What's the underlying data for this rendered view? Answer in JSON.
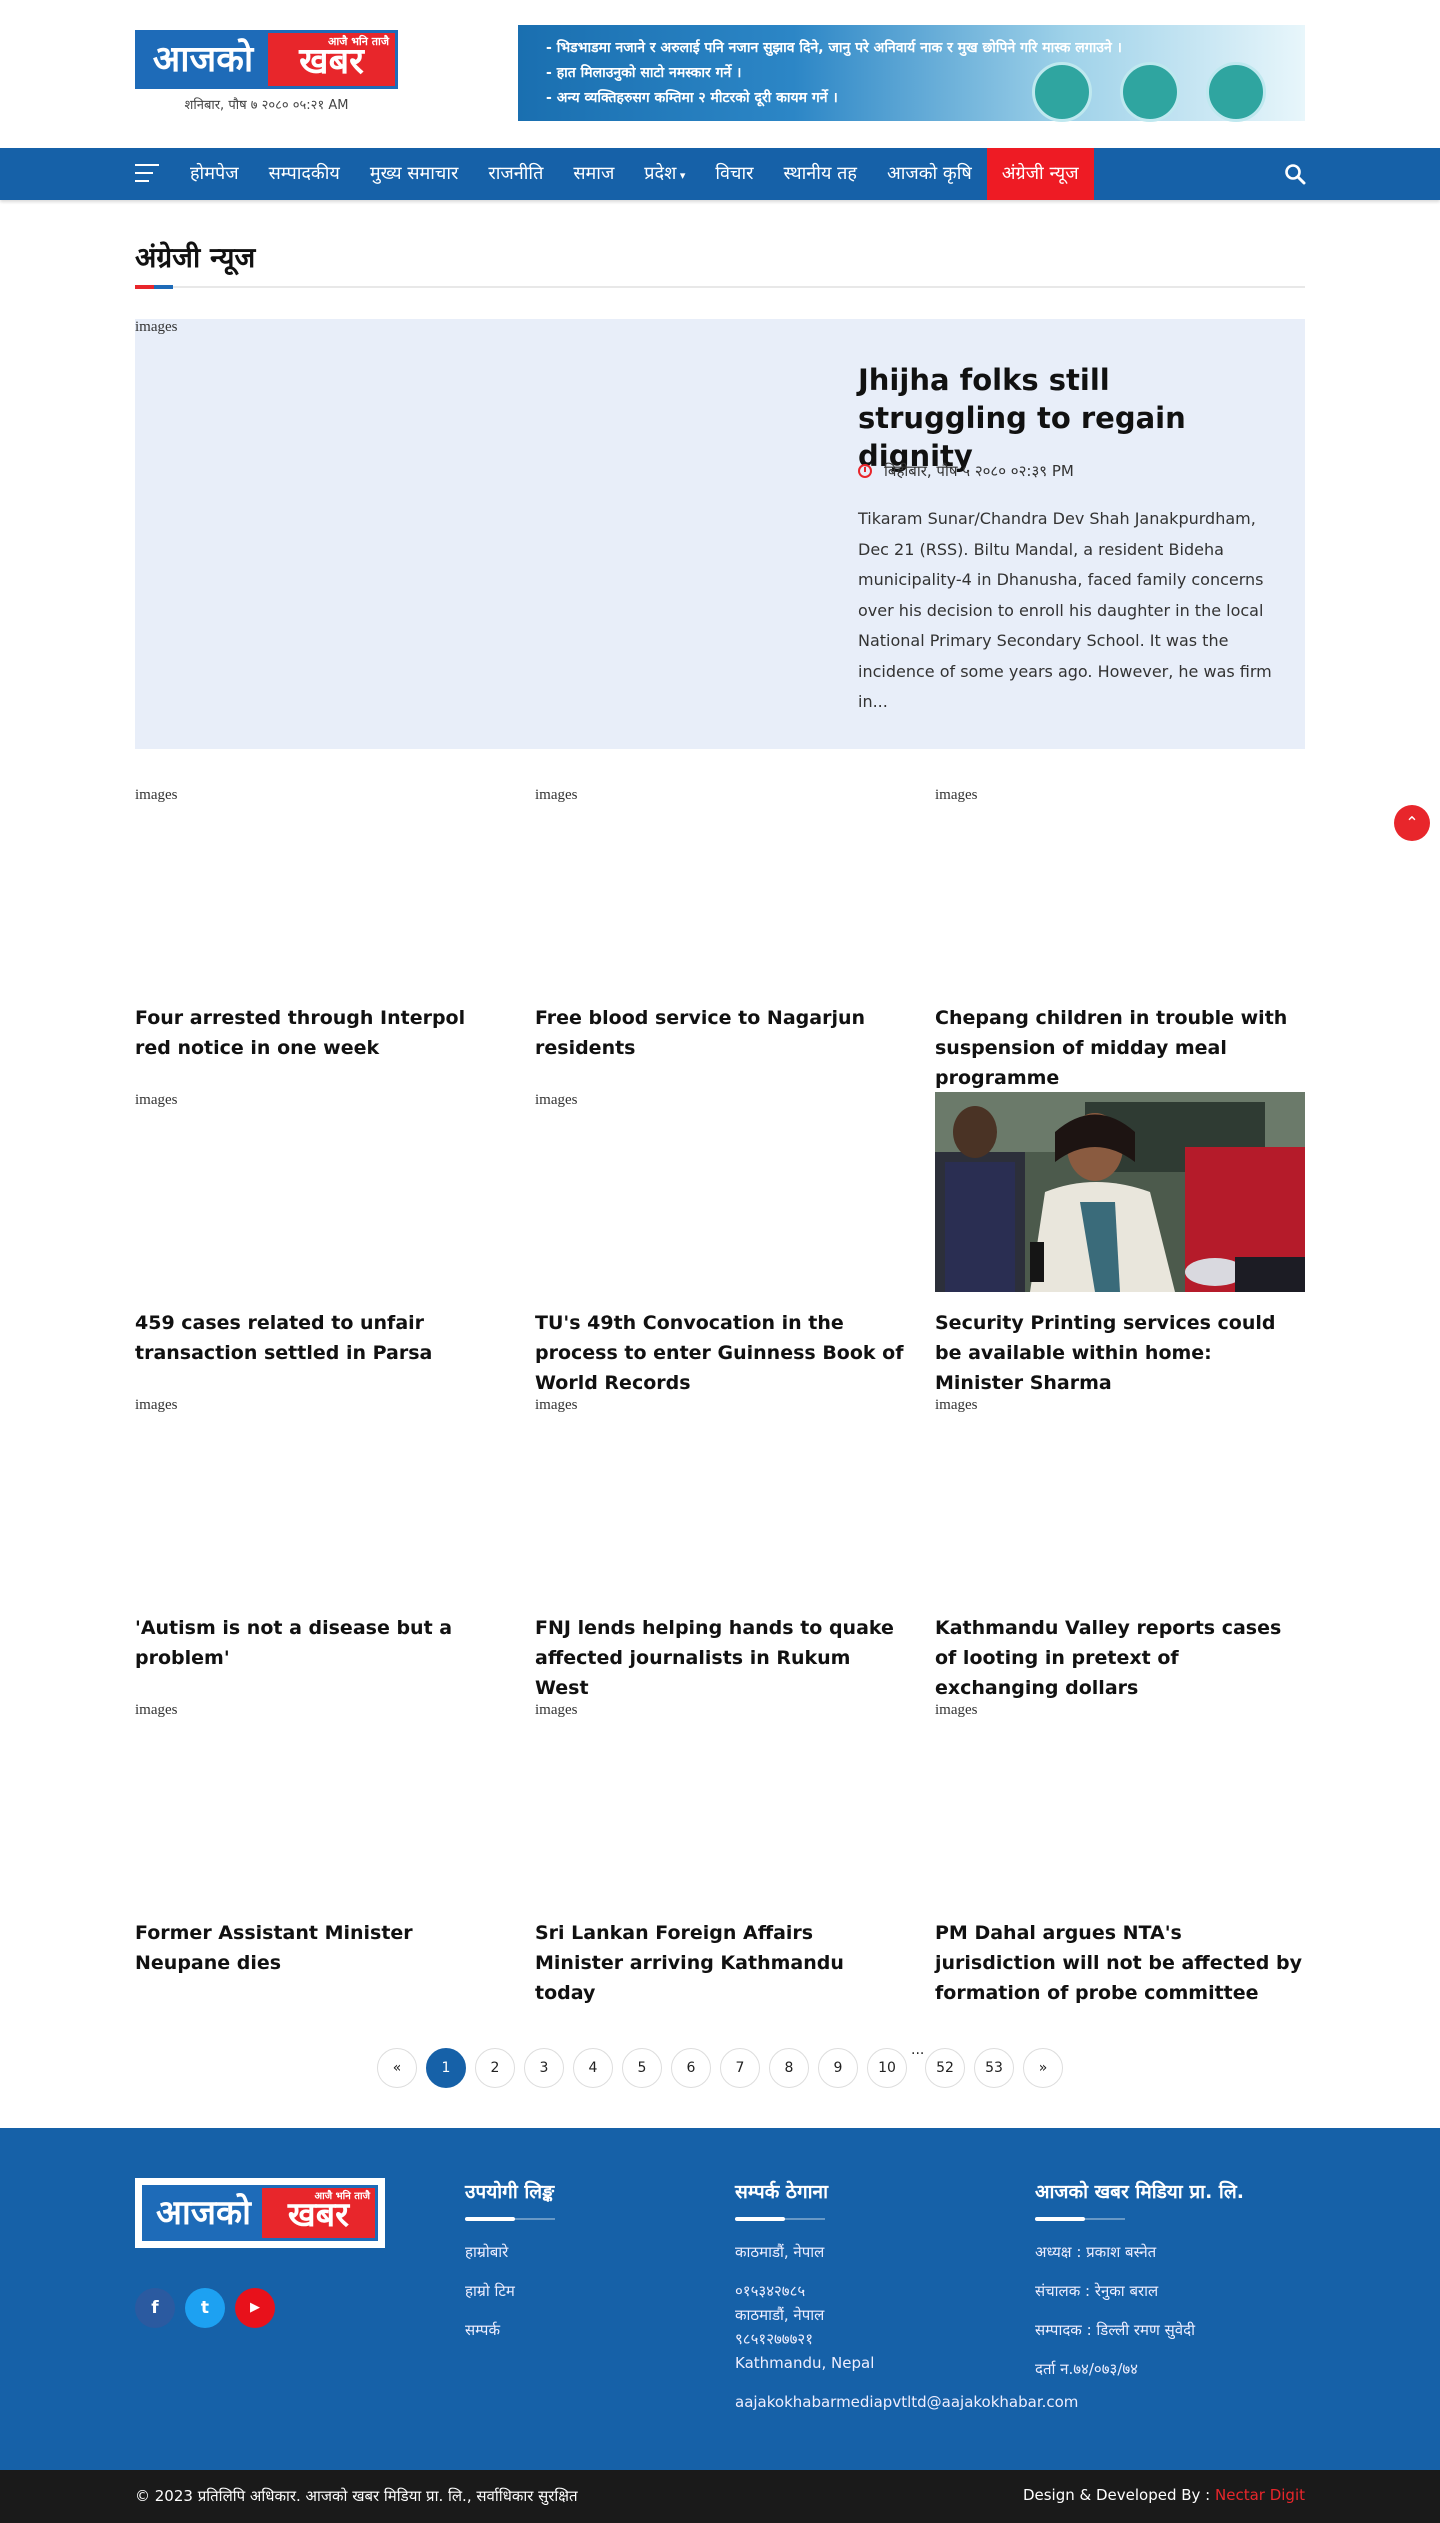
{
  "header": {
    "logo_left": "आजको",
    "logo_right": "खबर",
    "logo_tagline": "आजै भनि ताजै",
    "date": "शनिबार, पौष ७ २०८० ०५:२१ AM",
    "banner_lines": [
      "भिडभाडमा नजाने र अरुलाई पनि नजान सुझाव दिने, जानु परे अनिवार्य नाक र मुख छोपिने गरि मास्क लगाउने ।",
      "हात मिलाउनुको साटो नमस्कार गर्ने ।",
      "अन्य व्यक्तिहरुसग कम्तिमा २ मीटरको दूरी कायम गर्ने ।"
    ]
  },
  "nav": {
    "items": [
      {
        "label": "होमपेज"
      },
      {
        "label": "सम्पादकीय"
      },
      {
        "label": "मुख्य समाचार"
      },
      {
        "label": "राजनीति"
      },
      {
        "label": "समाज"
      },
      {
        "label": "प्रदेश"
      },
      {
        "label": "विचार"
      },
      {
        "label": "स्थानीय तह"
      },
      {
        "label": "आजको कृषि"
      },
      {
        "label": "अंग्रेजी न्यूज"
      }
    ]
  },
  "section": {
    "title": "अंग्रेजी न्यूज"
  },
  "featured": {
    "image_alt": "images",
    "title": "Jhijha folks still struggling to regain dignity",
    "date": "बिहीबार, पौष ५ २०८० ०२:३९ PM",
    "excerpt": "Tikaram Sunar/Chandra Dev Shah  Janakpurdham, Dec 21 (RSS). Biltu Mandal, a resident Bideha municipality-4 in Dhanusha, faced family concerns over his decision to enroll his daughter in the local National Primary Secondary School. It was the incidence of some years ago. However, he was firm in..."
  },
  "articles": [
    {
      "image_alt": "images",
      "title": "Four arrested through Interpol red notice in one week"
    },
    {
      "image_alt": "images",
      "title": "Free blood service to Nagarjun residents"
    },
    {
      "image_alt": "images",
      "title": "Chepang children in trouble with suspension of midday meal programme"
    },
    {
      "image_alt": "images",
      "title": "459 cases related to unfair transaction settled in Parsa"
    },
    {
      "image_alt": "images",
      "title": "TU's 49th Convocation in the process to enter Guinness Book of World Records"
    },
    {
      "image_alt": "",
      "title": "Security Printing services could be available within home: Minister Sharma"
    },
    {
      "image_alt": "images",
      "title": "'Autism is not a disease but a problem'"
    },
    {
      "image_alt": "images",
      "title": "FNJ lends helping hands to quake affected journalists in Rukum West"
    },
    {
      "image_alt": "images",
      "title": "Kathmandu Valley reports cases of looting in pretext of exchanging dollars"
    },
    {
      "image_alt": "images",
      "title": "Former Assistant Minister Neupane dies"
    },
    {
      "image_alt": "images",
      "title": "Sri Lankan Foreign Affairs Minister arriving Kathmandu today"
    },
    {
      "image_alt": "images",
      "title": "PM Dahal argues NTA's jurisdiction will not be affected by formation of probe committee"
    }
  ],
  "pagination": {
    "prev": "«",
    "next": "»",
    "pages": [
      "1",
      "2",
      "3",
      "4",
      "5",
      "6",
      "7",
      "8",
      "9",
      "10"
    ],
    "dots": "...",
    "last_pages": [
      "52",
      "53"
    ],
    "current": "1"
  },
  "footer": {
    "logo_left": "आजको",
    "logo_right": "खबर",
    "logo_tagline": "आजै भनि ताजै",
    "social": {
      "facebook": "f",
      "twitter": "t",
      "youtube": "▶"
    },
    "links": {
      "title": "उपयोगी लिङ्क",
      "items": [
        "हाम्रोबारे",
        "हाम्रो टिम",
        "सम्पर्क"
      ]
    },
    "contact": {
      "title": "सम्पर्क ठेगाना",
      "address": "काठमाडौं, नेपाल",
      "lines": [
        "०१५३४२७८५",
        "काठमाडौं, नेपाल",
        "९८५१२७७७२१",
        "Kathmandu, Nepal"
      ],
      "email": "aajakokhabarmediapvtltd@aajakokhabar.com"
    },
    "company": {
      "title": "आजको खबर मिडिया प्रा. लि.",
      "items": [
        "अध्यक्ष : प्रकाश बस्नेत",
        "संचालक : रेनुका बराल",
        "सम्पादक : डिल्ली रमण सुवेदी",
        "दर्ता न.७४/०७३/७४"
      ]
    }
  },
  "copyright": {
    "text": "© 2023 प्रतिलिपि अधिकार. आजको खबर मिडिया प्रा. लि., सर्वाधिकार सुरक्षित",
    "credit_prefix": "Design & Developed By :",
    "credit_brand": "Nectar Digit"
  },
  "colors": {
    "primary_blue": "#1661a8",
    "accent_red": "#e8262b",
    "featured_bg": "#e8eef9",
    "footer_bottom": "#1a1a1a"
  }
}
